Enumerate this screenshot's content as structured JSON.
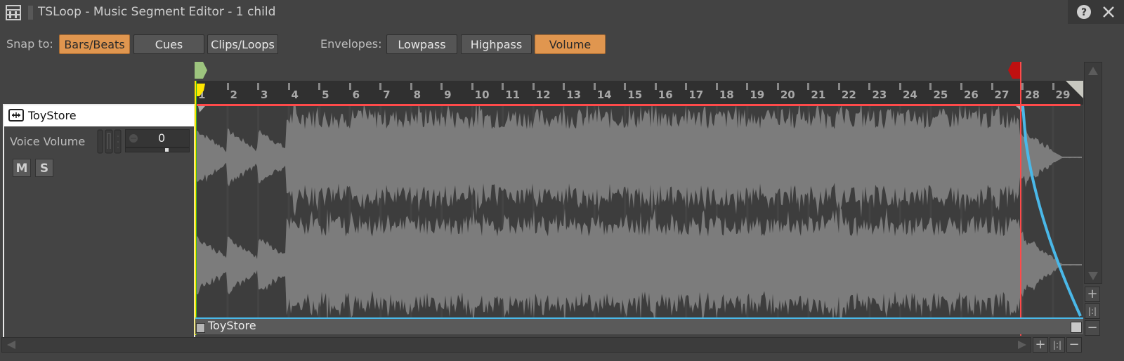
{
  "window": {
    "title": "TSLoop - Music Segment Editor - 1 child",
    "icons": [
      "mixer-icon",
      "help-icon",
      "close-icon"
    ]
  },
  "toolbar": {
    "snap_label": "Snap to:",
    "snap_options": [
      {
        "label": "Bars/Beats",
        "active": true
      },
      {
        "label": "Cues",
        "active": false
      },
      {
        "label": "Clips/Loops",
        "active": false
      }
    ],
    "envelopes_label": "Envelopes:",
    "envelope_options": [
      {
        "label": "Lowpass",
        "active": false
      },
      {
        "label": "Highpass",
        "active": false
      },
      {
        "label": "Volume",
        "active": true
      }
    ]
  },
  "track": {
    "name": "ToyStore",
    "voice_volume_label": "Voice Volume",
    "voice_volume_value": "0",
    "mute_label": "M",
    "solo_label": "S"
  },
  "timeline": {
    "bars": [
      "1",
      "2",
      "3",
      "4",
      "5",
      "6",
      "7",
      "8",
      "9",
      "10",
      "11",
      "12",
      "13",
      "14",
      "15",
      "16",
      "17",
      "18",
      "19",
      "20",
      "21",
      "22",
      "23",
      "24",
      "25",
      "26",
      "27",
      "28",
      "29"
    ],
    "playhead_bar": 28,
    "entry_bar": 1
  },
  "clip": {
    "name": "ToyStore"
  },
  "colors": {
    "accent_active": "#e0964f",
    "loop_line": "#ff4a4a",
    "envelope": "#4ab8e8",
    "entry_cue": "#ffe600",
    "start_marker": "#9dc47e",
    "exit_marker": "#c01010"
  }
}
